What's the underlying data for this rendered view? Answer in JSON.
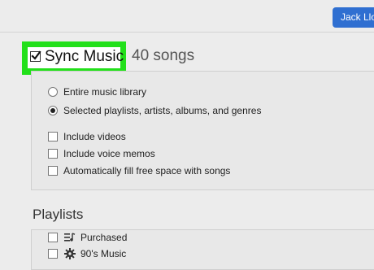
{
  "header": {
    "account_label": "Jack Llo"
  },
  "sync": {
    "label": "Sync Music",
    "checked": true,
    "song_count": "40 songs",
    "highlight_color": "#22e01a"
  },
  "options": {
    "radios": [
      {
        "label": "Entire music library",
        "selected": false
      },
      {
        "label": "Selected playlists, artists, albums, and genres",
        "selected": true
      }
    ],
    "checkboxes": [
      {
        "label": "Include videos",
        "checked": false
      },
      {
        "label": "Include voice memos",
        "checked": false
      },
      {
        "label": "Automatically fill free space with songs",
        "checked": false
      }
    ]
  },
  "playlists": {
    "heading": "Playlists",
    "items": [
      {
        "label": "Purchased",
        "icon": "purchased-list-icon",
        "checked": false
      },
      {
        "label": "90's Music",
        "icon": "smart-playlist-gear-icon",
        "checked": false
      }
    ]
  },
  "colors": {
    "accent": "#2f6fd1",
    "background": "#ececec"
  }
}
